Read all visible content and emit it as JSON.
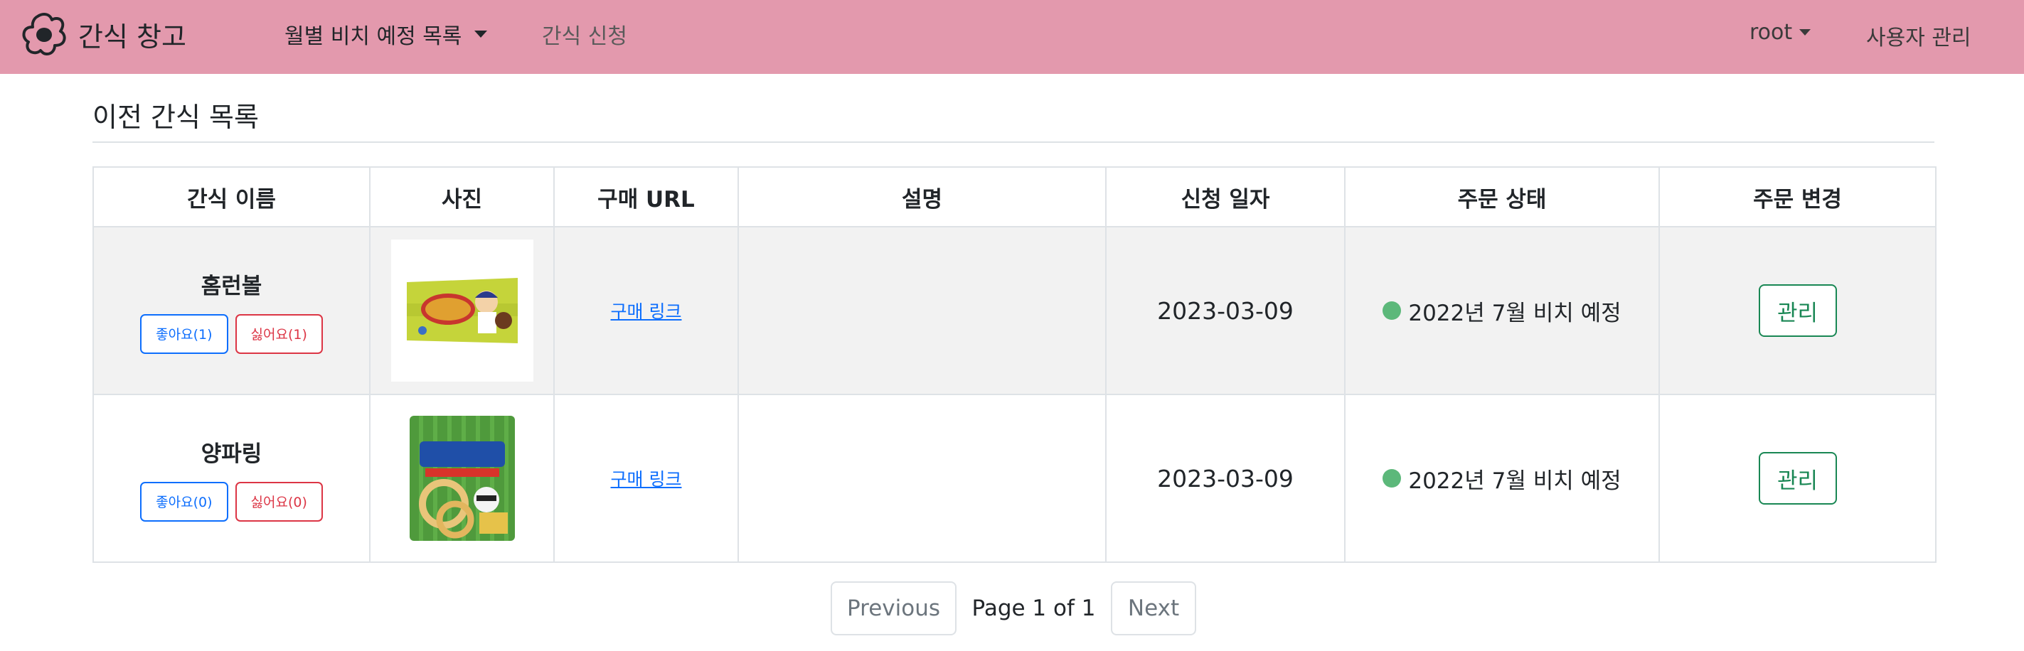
{
  "nav": {
    "brand": "간식 창고",
    "monthly_dropdown": "월별 비치 예정 목록",
    "request_link": "간식 신청",
    "user_menu": "root",
    "admin_link": "사용자 관리"
  },
  "page": {
    "title": "이전 간식 목록"
  },
  "table": {
    "headers": [
      "간식 이름",
      "사진",
      "구매 URL",
      "설명",
      "신청 일자",
      "주문 상태",
      "주문 변경"
    ],
    "rows": [
      {
        "name": "홈런볼",
        "like_label": "좋아요(1)",
        "dislike_label": "싫어요(1)",
        "link_label": "구매 링크",
        "description": "",
        "date": "2023-03-09",
        "status": "2022년 7월 비치 예정",
        "status_color": "#5cb87a",
        "manage_label": "관리"
      },
      {
        "name": "양파링",
        "like_label": "좋아요(0)",
        "dislike_label": "싫어요(0)",
        "link_label": "구매 링크",
        "description": "",
        "date": "2023-03-09",
        "status": "2022년 7월 비치 예정",
        "status_color": "#5cb87a",
        "manage_label": "관리"
      }
    ]
  },
  "pagination": {
    "previous_label": "Previous",
    "page_info": "Page 1 of 1",
    "next_label": "Next"
  },
  "colors": {
    "navbar": "#e399ad",
    "primary": "#0d6efd",
    "danger": "#dc3545",
    "success": "#198754"
  }
}
